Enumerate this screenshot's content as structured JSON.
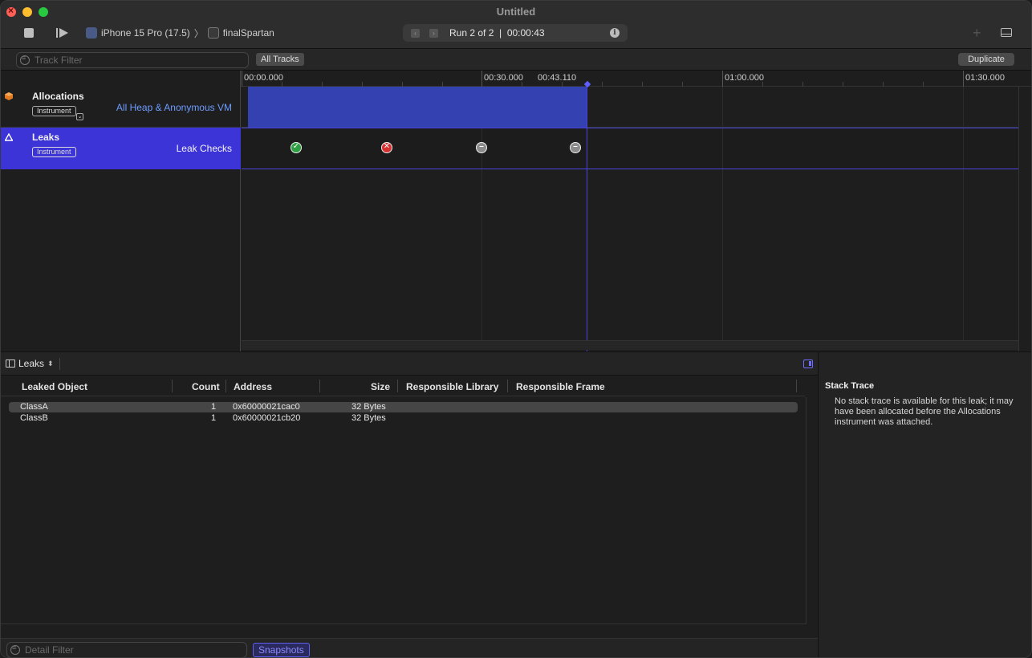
{
  "window": {
    "title": "Untitled"
  },
  "toolbar": {
    "device": "iPhone 15 Pro (17.5)",
    "app": "finalSpartan",
    "run_text": "Run 2 of 2  |  00:00:43"
  },
  "filterbar": {
    "track_filter_placeholder": "Track Filter",
    "all_tracks_label": "All Tracks",
    "duplicate_label": "Duplicate"
  },
  "ruler": {
    "ticks": [
      "00:00.000",
      "00:30.000",
      "00:43.110",
      "01:00.000",
      "01:30.000"
    ]
  },
  "tracks": [
    {
      "name": "Allocations",
      "badge": "Instrument",
      "detail": "All Heap & Anonymous VM"
    },
    {
      "name": "Leaks",
      "badge": "Instrument",
      "detail": "Leak Checks"
    }
  ],
  "leak_checks": [
    {
      "status": "ok",
      "symbol": "✓"
    },
    {
      "status": "bad",
      "symbol": "✕"
    },
    {
      "status": "none",
      "symbol": "–"
    },
    {
      "status": "none",
      "symbol": "–"
    }
  ],
  "detail": {
    "view_menu": "Leaks",
    "columns": [
      "Leaked Object",
      "Count",
      "Address",
      "Size",
      "Responsible Library",
      "Responsible Frame"
    ],
    "rows": [
      {
        "object": "ClassA",
        "count": "1",
        "address": "0x60000021cac0",
        "size": "32 Bytes",
        "library": "",
        "frame": ""
      },
      {
        "object": "ClassB",
        "count": "1",
        "address": "0x60000021cb20",
        "size": "32 Bytes",
        "library": "",
        "frame": ""
      }
    ],
    "filter_placeholder": "Detail Filter",
    "snapshots_label": "Snapshots"
  },
  "inspector": {
    "title": "Stack Trace",
    "message": "No stack trace is available for this leak; it may have been allocated before the Allocations instrument was attached."
  },
  "colors": {
    "selection": "#3d34d8",
    "allocation_graph": "#3441b0",
    "playhead": "#4a43e0"
  }
}
